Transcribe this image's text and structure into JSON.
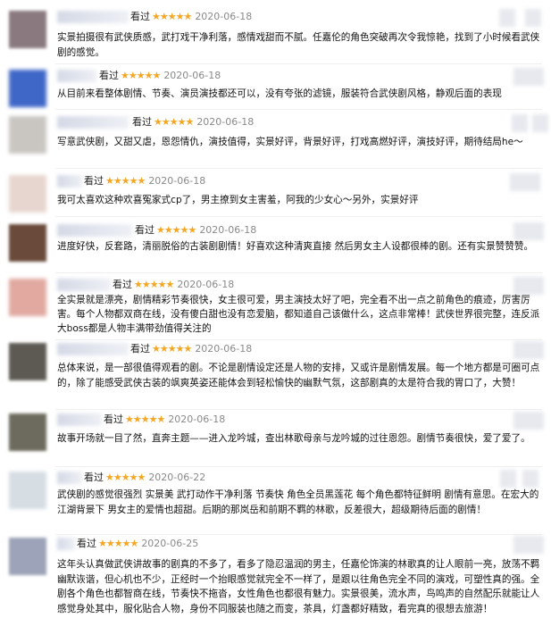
{
  "labels": {
    "seen": "看过"
  },
  "colors": {
    "stars": "#f5a623",
    "date": "#8a8a8a",
    "text": "#111111"
  },
  "reviews": [
    {
      "stars": "★★★★★",
      "date": "2020-06-18",
      "avatar_color": "#8a7a80",
      "text": "实景拍摄很有武侠质感，武打戏干净利落，感情戏甜而不腻。任嘉伦的角色突破再次令我惊艳，找到了小时候看武侠剧的感觉。"
    },
    {
      "stars": "★★★★★",
      "date": "2020-06-18",
      "avatar_color": "#3f67c7",
      "text": "从目前来看整体剧情、节奏、演员演技都还可以，没有夸张的滤镜，服装符合武侠剧风格，静观后面的表现"
    },
    {
      "stars": "★★★★★",
      "date": "2020-06-18",
      "avatar_color": "#c9c6c2",
      "text": "写意武侠剧，又甜又虐，恩怨情仇，演技值得，实景好评，背景好评，打戏高燃好评，演技好评，期待结局he～"
    },
    {
      "stars": "★★★★★",
      "date": "2020-06-18",
      "avatar_color": "#e7d6cf",
      "text": "我可太喜欢这种欢喜冤家式cp了，男主撩到女主害羞，阿我的少女心～另外，实景好评"
    },
    {
      "stars": "★★★★★",
      "date": "2020-06-18",
      "avatar_color": "#6a4a3a",
      "text": "进度好快，反套路，清丽脱俗的古装剧剧情！好喜欢这种清爽直接 然后男女主人设都很棒的剧。还有实景赞赞赞。"
    },
    {
      "stars": "★★★★★",
      "date": "2020-06-18",
      "avatar_color": "#e1a9a0",
      "text": "全实景就是漂亮，剧情精彩节奏很快，女主很可爱，男主演技太好了吧，完全看不出一点之前角色的痕迹，厉害厉害。每个人物都双商在线，没有傻白甜也没有恋爱脑，都知道自己该做什么，这点非常棒！武侠世界很完整，连反派大boss都是人物丰满带劲值得关注的"
    },
    {
      "stars": "★★★★★",
      "date": "2020-06-18",
      "avatar_color": "#5c5a52",
      "text": "总体来说，是一部很值得观看的剧。不论是剧情设定还是人物的安排，又或许是剧情发展。每一个地方都是可圈可点的，除了能感受武侠古装的飒爽英姿还能体会到轻松愉快的幽默气氛，这部剧真的太是符合我的胃口了，大赞！"
    },
    {
      "stars": "★★★★★",
      "date": "2020-06-18",
      "avatar_color": "#6d6b5d",
      "text": "故事开场就一目了然，直奔主题——进入龙吟城，查出林歌母亲与龙吟城的过往恩怨。剧情节奏很快，爱了爱了。"
    },
    {
      "stars": "★★★★★",
      "date": "2020-06-22",
      "avatar_color": "#d6dde3",
      "text": "武侠剧的感觉很强烈 实景美 武打动作干净利落 节奏快 角色全员黑莲花 每个角色都特征鲜明 剧情有意思。在宏大的江湖背景下 男女主的爱情也超甜。后期的那岚岳和前期不羁的林歌，反差很大，超级期待后面的剧情！"
    },
    {
      "stars": "★★★★★",
      "date": "2020-06-25",
      "avatar_color": "#9da3b8",
      "text": "这年头认真做武侠讲故事的剧真的不多了，看多了隐忍温润的男主，任嘉伦饰演的林歌真的让人眼前一亮，放荡不羁幽默诙谐，但心机也不少，正经时一个抬眼感觉就完全不一样了，是跟以往角色完全不同的演戏，可塑性真的强。全剧各个角色也都智商在线，节奏快不拖沓，女性角色也都很有魅力。实景很美，流水声，鸟鸣声的自然配乐就能让人感觉身处其中，服化贴合人物，身份不同服装也随之而变，茶具，灯盏都好精致，看完真的很想去旅游！"
    }
  ]
}
